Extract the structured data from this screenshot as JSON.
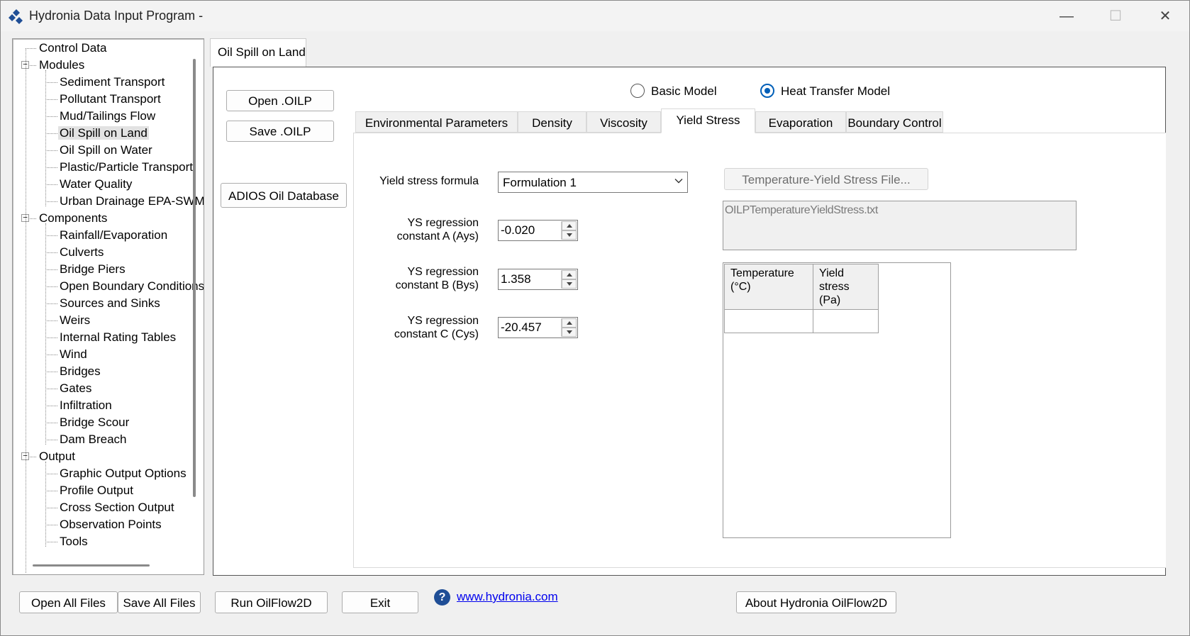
{
  "window": {
    "title": "Hydronia Data Input Program -"
  },
  "tree": {
    "items": [
      {
        "label": "Control Data",
        "level": 0
      },
      {
        "label": "Modules",
        "level": 0,
        "expander": "−"
      },
      {
        "label": "Sediment Transport",
        "level": 1
      },
      {
        "label": "Pollutant Transport",
        "level": 1
      },
      {
        "label": "Mud/Tailings Flow",
        "level": 1
      },
      {
        "label": "Oil Spill on Land",
        "level": 1,
        "selected": true
      },
      {
        "label": "Oil Spill on Water",
        "level": 1
      },
      {
        "label": "Plastic/Particle Transport",
        "level": 1
      },
      {
        "label": "Water Quality",
        "level": 1
      },
      {
        "label": "Urban Drainage EPA-SWMM",
        "level": 1
      },
      {
        "label": "Components",
        "level": 0,
        "expander": "−"
      },
      {
        "label": "Rainfall/Evaporation",
        "level": 1
      },
      {
        "label": "Culverts",
        "level": 1
      },
      {
        "label": "Bridge Piers",
        "level": 1
      },
      {
        "label": "Open Boundary Conditions",
        "level": 1
      },
      {
        "label": "Sources and Sinks",
        "level": 1
      },
      {
        "label": "Weirs",
        "level": 1
      },
      {
        "label": "Internal Rating Tables",
        "level": 1
      },
      {
        "label": "Wind",
        "level": 1
      },
      {
        "label": "Bridges",
        "level": 1
      },
      {
        "label": "Gates",
        "level": 1
      },
      {
        "label": "Infiltration",
        "level": 1
      },
      {
        "label": "Bridge Scour",
        "level": 1
      },
      {
        "label": "Dam Breach",
        "level": 1
      },
      {
        "label": "Output",
        "level": 0,
        "expander": "−"
      },
      {
        "label": "Graphic Output Options",
        "level": 1
      },
      {
        "label": "Profile Output",
        "level": 1
      },
      {
        "label": "Cross Section Output",
        "level": 1
      },
      {
        "label": "Observation Points",
        "level": 1
      },
      {
        "label": "Tools",
        "level": 1
      }
    ]
  },
  "outer_tab": {
    "label": "Oil Spill on Land"
  },
  "side_buttons": {
    "open": "Open .OILP",
    "save": "Save .OILP",
    "adios": "ADIOS Oil Database"
  },
  "model": {
    "basic_label": "Basic Model",
    "heat_label": "Heat Transfer Model",
    "selected": "heat"
  },
  "tabs": [
    {
      "label": "Environmental Parameters"
    },
    {
      "label": "Density"
    },
    {
      "label": "Viscosity"
    },
    {
      "label": "Yield Stress",
      "active": true
    },
    {
      "label": "Evaporation"
    },
    {
      "label": "Boundary Control"
    }
  ],
  "yield_stress": {
    "formula_label": "Yield stress formula",
    "formula_value": "Formulation 1",
    "a_label_1": "YS regression",
    "a_label_2": "constant A (Ays)",
    "a_value": "-0.020",
    "b_label_1": "YS regression",
    "b_label_2": "constant B (Bys)",
    "b_value": "1.358",
    "c_label_1": "YS regression",
    "c_label_2": "constant C (Cys)",
    "c_value": "-20.457",
    "file_button": "Temperature-Yield Stress File...",
    "file_path": "OILPTemperatureYieldStress.txt",
    "table_headers": [
      {
        "line1": "Temperature",
        "line2": "(°C)"
      },
      {
        "line1": "Yield",
        "line2": "stress (Pa)"
      }
    ]
  },
  "bottom_bar": {
    "open_all": "Open All Files",
    "save_all": "Save All Files",
    "run": "Run OilFlow2D",
    "exit": "Exit",
    "help_glyph": "?",
    "link": "www.hydronia.com",
    "about": "About Hydronia OilFlow2D"
  }
}
